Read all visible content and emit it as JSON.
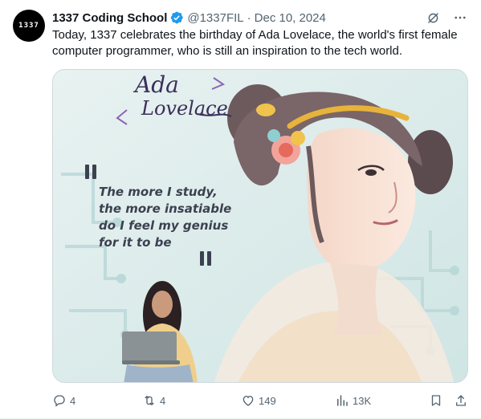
{
  "post": {
    "avatar_text": "1337",
    "display_name": "1337 Coding School",
    "handle": "@1337FIL",
    "separator": "·",
    "date": "Dec 10, 2024",
    "text": "Today, 1337 celebrates the birthday of Ada Lovelace, the world's first female computer programmer, who is still an inspiration to the tech world."
  },
  "media": {
    "title_line1": "Ada",
    "title_line2": "Lovelace",
    "quote_lines": [
      "The more I study,",
      "the more insatiable",
      "do I feel my genius",
      "for it to be"
    ]
  },
  "actions": {
    "replies": "4",
    "reposts": "4",
    "likes": "149",
    "views": "13K"
  },
  "colors": {
    "verified": "#1d9bf0",
    "muted": "#536471",
    "text": "#0f1419"
  },
  "icons": [
    "verified-icon",
    "grok-icon",
    "more-icon",
    "reply-icon",
    "repost-icon",
    "like-icon",
    "views-icon",
    "bookmark-icon",
    "share-icon"
  ]
}
